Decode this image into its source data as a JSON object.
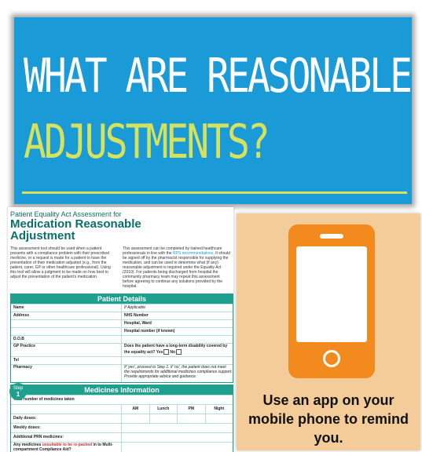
{
  "banner": {
    "line1": "WHAT ARE REASONABLE",
    "line2": "ADJUSTMENTS?",
    "bg_color": "#1a9ad6",
    "accent_color": "#d7e25c"
  },
  "document": {
    "subtitle": "Patient Equality Act Assessment for",
    "title_line1": "Medication Reasonable",
    "title_line2": "Adjustment",
    "intro_left": "This assessment tool should be used when a patient presents with a compliance problem with their prescribed medicine, or a request is made for a patient to have the presentation of their medication adjusted (e.g., from the patient, carer, GP or other healthcare professional). Using this tool will allow a judgment to be made on how best to adjust the presentation of the patient's medication.",
    "intro_right_a": "This assessment can be completed by trained healthcare professionals in line with the ",
    "intro_right_link": "RPS recommendations",
    "intro_right_b": ". It should be signed off by the pharmacist responsible for supplying the medication, and can be used to determine what (if any) reasonable adjustment is required under the Equality Act (2010). For patients being discharged from hospital the community pharmacy team may repeat this assessment before agreeing to continue any solutions provided by the hospital.",
    "patient_details": {
      "heading": "Patient Details",
      "name_label": "Name",
      "if_applicable": "If Applicable",
      "address_label": "Address",
      "nhs_number": "NHS Number",
      "hospital_ward": "Hospital, Ward",
      "hospital_number": "Hospital number (if known)",
      "dob_label": "D.O.B",
      "gp_practice_label": "GP Practice",
      "disability_question": "Does the patient have a long-term disability covered by the equality act?",
      "yes_label": "Yes",
      "no_label": "No",
      "tel_label": "Tel",
      "pharmacy_label": "Pharmacy",
      "proceed_note": "If 'yes', proceed to Step 1. If 'no', the patient does not meet the requirements for additional medicines compliance support. Provide appropriate advice and guidance."
    },
    "medicines": {
      "step_word": "Step",
      "step_number": "1",
      "heading": "Medicines Information",
      "total_label": "Total number of medicines taken",
      "columns": [
        "AM",
        "Lunch",
        "PM",
        "Night"
      ],
      "daily_doses": "Daily doses:",
      "weekly_doses": "Weekly doses:",
      "prn": "Additional PRN medicines:",
      "unsuitable_a": "Any medicines ",
      "unsuitable_b": "unsuitable to be re-packed",
      "unsuitable_c": "in to Multi-compartment Compliance Aid?"
    }
  },
  "panel": {
    "caption": "Use an app on your mobile phone to remind you.",
    "phone_color": "#f38a1e",
    "bg_color": "#f3cc9a"
  }
}
